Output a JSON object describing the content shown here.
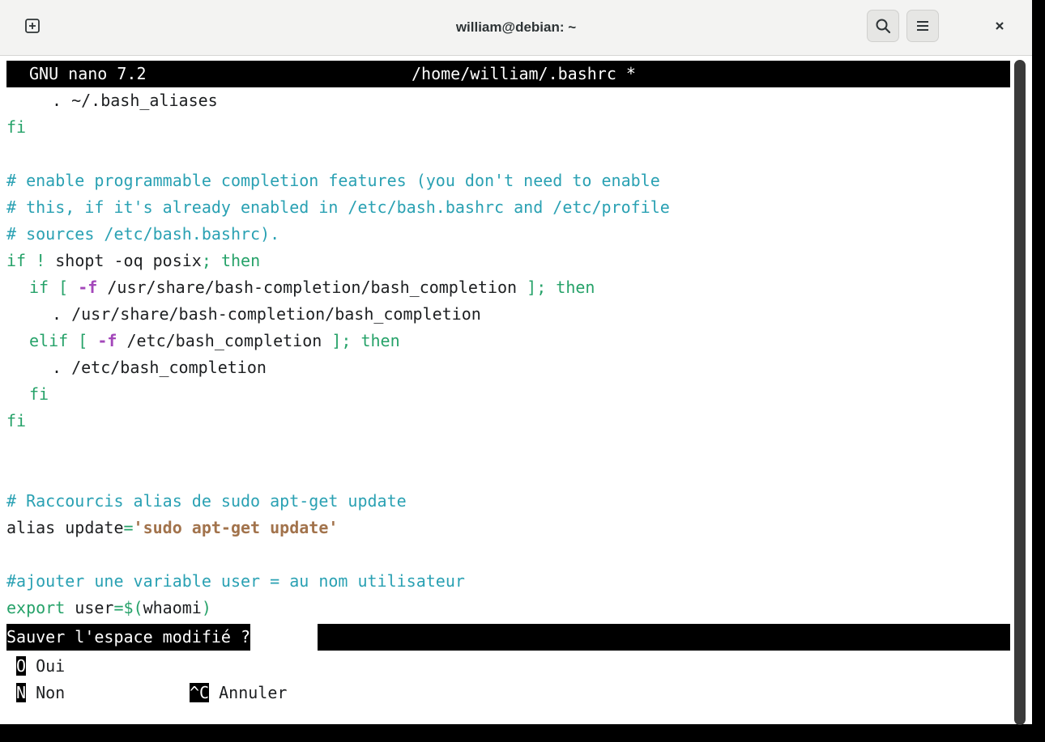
{
  "window": {
    "title": "william@debian: ~",
    "icons": {
      "new_tab": "new-tab-icon",
      "search": "search-icon",
      "menu": "hamburger-menu-icon",
      "close": "close-icon"
    }
  },
  "nano": {
    "version": "GNU nano 7.2",
    "filename": "/home/william/.bashrc *"
  },
  "lines": {
    "l1": ". ~/.bash_aliases",
    "l2": "fi",
    "l4": "# enable programmable completion features (you don't need to enable",
    "l5": "# this, if it's already enabled in /etc/bash.bashrc and /etc/profile",
    "l6": "# sources /etc/bash.bashrc).",
    "l7": {
      "kw1": "if",
      "op": "!",
      "cmd": "shopt -oq posix",
      "semi": ";",
      "kw2": "then"
    },
    "l8": {
      "kw1": "if",
      "br1": "[",
      "opt": "-f",
      "path": "/usr/share/bash-completion/bash_completion",
      "br2": "];",
      "kw2": "then"
    },
    "l9": ". /usr/share/bash-completion/bash_completion",
    "l10": {
      "kw1": "elif",
      "br1": "[",
      "opt": "-f",
      "path": "/etc/bash_completion",
      "br2": "];",
      "kw2": "then"
    },
    "l11": ". /etc/bash_completion",
    "l12": "fi",
    "l13": "fi",
    "l17": "# Raccourcis alias de sudo apt-get update",
    "l18": {
      "cmd": "alias update",
      "eq": "=",
      "str": "'sudo apt-get update'"
    },
    "l20": "#ajouter une variable user = au nom utilisateur",
    "l21": {
      "kw": "export",
      "var": "user",
      "eq": "=$(",
      "sub": "whaomi",
      "close": ")"
    }
  },
  "prompt": {
    "question": "Sauver l'espace modifié ?",
    "options": [
      {
        "key": "O",
        "label": "Oui"
      },
      {
        "key": "N",
        "label": "Non"
      },
      {
        "key": "^C",
        "label": "Annuler"
      }
    ]
  },
  "colors": {
    "comment": "#2aa1b3",
    "keyword": "#26a269",
    "option": "#a347ba",
    "string": "#a2734c"
  }
}
